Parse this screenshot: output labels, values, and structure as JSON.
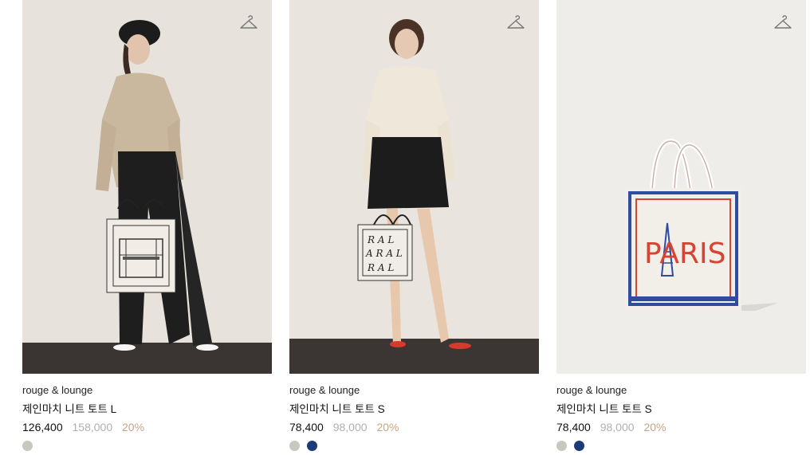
{
  "products": [
    {
      "brand": "rouge & lounge",
      "name": "제인마치 니트 토트 L",
      "sale_price": "126,400",
      "original_price": "158,000",
      "discount": "20%",
      "image_desc": "model-with-storefront-tote",
      "swatches": [
        "#c8c8c0"
      ],
      "icon": "hanger-icon"
    },
    {
      "brand": "rouge & lounge",
      "name": "제인마치 니트 토트 S",
      "sale_price": "78,400",
      "original_price": "98,000",
      "discount": "20%",
      "image_desc": "model-with-ral-tote",
      "swatches": [
        "#c8c8c0",
        "#1f3a7a"
      ],
      "icon": "hanger-icon"
    },
    {
      "brand": "rouge & lounge",
      "name": "제인마치 니트 토트 S",
      "sale_price": "78,400",
      "original_price": "98,000",
      "discount": "20%",
      "image_desc": "paris-tote-product",
      "image_text": "PARIS",
      "swatches": [
        "#c8c8c0",
        "#1f3a7a"
      ],
      "icon": "hanger-icon"
    }
  ],
  "colors": {
    "discount": "#c7a486",
    "original_price": "#b0b0b0",
    "text": "#111111"
  }
}
